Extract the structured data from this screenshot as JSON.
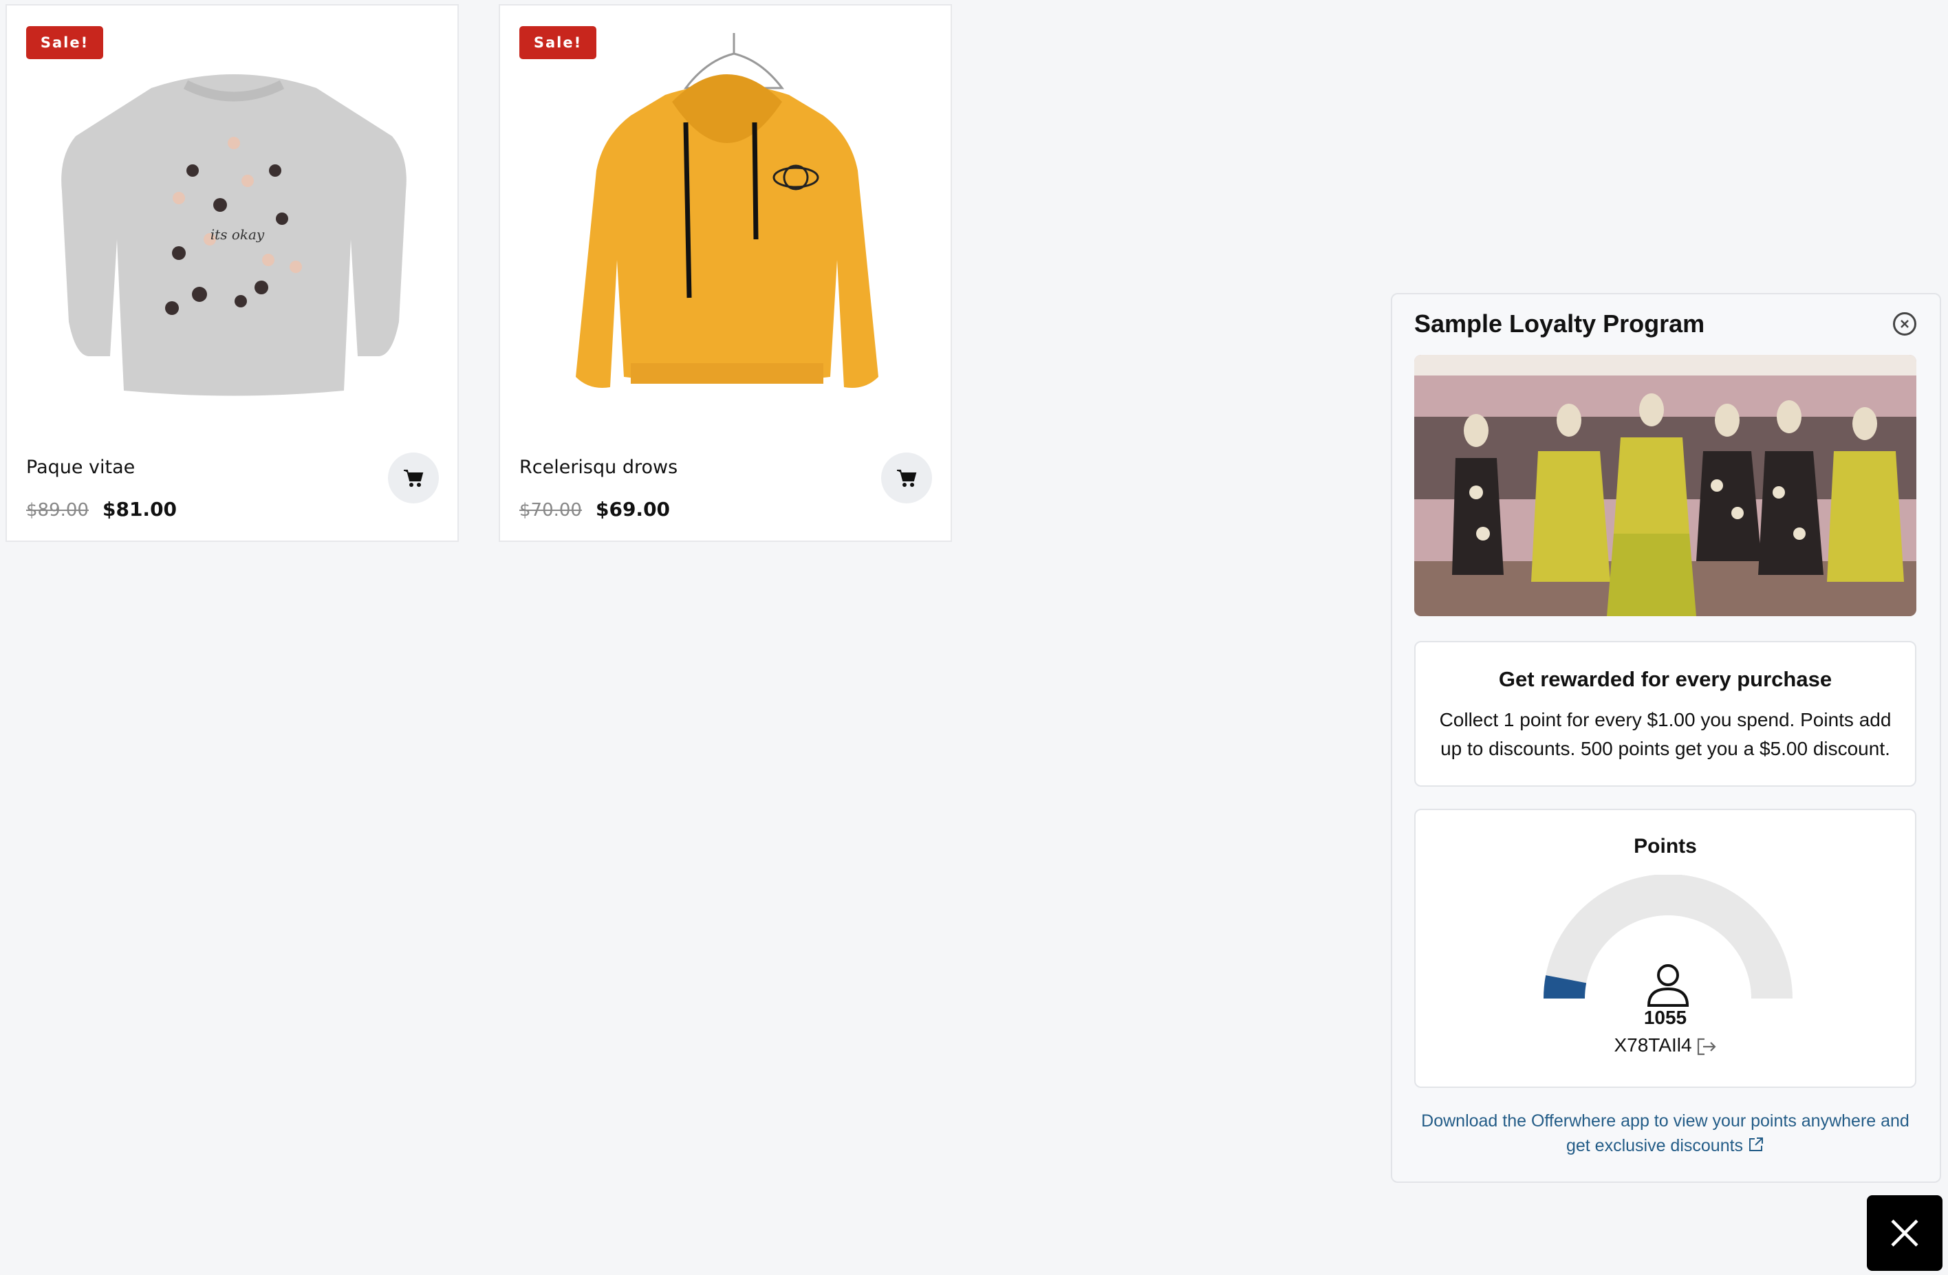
{
  "products": [
    {
      "badge": "Sale!",
      "name": "Paque vitae",
      "old_price": "$89.00",
      "price": "$81.00",
      "image": "grey-sweatshirt",
      "cart_icon": "cart-icon"
    },
    {
      "badge": "Sale!",
      "name": "Rcelerisqu drows",
      "old_price": "$70.00",
      "price": "$69.00",
      "image": "yellow-hoodie",
      "cart_icon": "cart-icon"
    }
  ],
  "loyalty": {
    "title": "Sample Loyalty Program",
    "hero_image": "store-mannequins-photo",
    "reward_heading": "Get rewarded for every purchase",
    "reward_text": "Collect 1 point for every $1.00 you spend. Points add up to discounts. 500 points get you a $5.00 discount.",
    "points_heading": "Points",
    "points_value": "1055",
    "gauge_fraction": 0.06,
    "member_code": "X78TAIl4",
    "download_text": "Download the Offerwhere app to view your points anywhere and get exclusive discounts",
    "accent": "#235c87"
  },
  "colors": {
    "sale_badge": "#c8261d",
    "gauge_fill": "#20558f",
    "gauge_track": "#e8e8e8"
  }
}
